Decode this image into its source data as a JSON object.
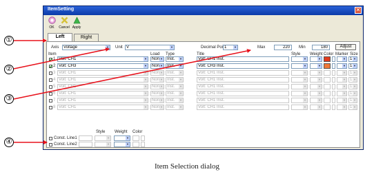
{
  "window": {
    "title": "ItemSetting",
    "close_glyph": "✕"
  },
  "toolbar": [
    {
      "label": "OK",
      "icon": "ok-icon"
    },
    {
      "label": "Cancel",
      "icon": "cancel-icon"
    },
    {
      "label": "Apply",
      "icon": "apply-icon"
    }
  ],
  "tabs": [
    {
      "label": "Left",
      "active": true
    },
    {
      "label": "Right",
      "active": false
    }
  ],
  "settings": {
    "axis_label": "Axis",
    "axis_value": "Voltage",
    "unit_label": "Unit",
    "unit_value": "V",
    "decimal_label": "Decimal Points",
    "decimal_value": "1",
    "max_label": "Max",
    "max_value": "220",
    "min_label": "Min",
    "min_value": "180",
    "adjust_button": "Adjust"
  },
  "headers": {
    "item": "Item",
    "load": "Load",
    "type": "Type",
    "title": "Title",
    "style": "Style",
    "weight": "Weight",
    "color": "Color",
    "marker": "Marker",
    "size": "Size"
  },
  "rows": [
    {
      "num": "1",
      "item": "Volt: CH1",
      "load": "None",
      "type": "Inst.",
      "title": "Volt: CH1 Inst.",
      "size": "1",
      "checked": true,
      "enabled": true,
      "color": "#e23a1c"
    },
    {
      "num": "2",
      "item": "Volt: CH3",
      "load": "None",
      "type": "Inst.",
      "title": "Volt: CH3 Inst.",
      "size": "1",
      "checked": true,
      "enabled": true,
      "color": "#f07838"
    },
    {
      "num": "3",
      "item": "Volt: CH1",
      "load": "None",
      "type": "Inst.",
      "title": "Volt: CH1 Inst.",
      "size": "1",
      "checked": false,
      "enabled": false,
      "color": ""
    },
    {
      "num": "4",
      "item": "Volt: CH1",
      "load": "None",
      "type": "Inst.",
      "title": "Volt: CH1 Inst.",
      "size": "1",
      "checked": false,
      "enabled": false,
      "color": ""
    },
    {
      "num": "5",
      "item": "Volt: CH1",
      "load": "None",
      "type": "Inst.",
      "title": "Volt: CH1 Inst.",
      "size": "1",
      "checked": false,
      "enabled": false,
      "color": ""
    },
    {
      "num": "6",
      "item": "Volt: CH1",
      "load": "None",
      "type": "Inst.",
      "title": "Volt: CH1 Inst.",
      "size": "1",
      "checked": false,
      "enabled": false,
      "color": ""
    },
    {
      "num": "7",
      "item": "Volt: CH1",
      "load": "None",
      "type": "Inst.",
      "title": "Volt: CH1 Inst.",
      "size": "1",
      "checked": false,
      "enabled": false,
      "color": ""
    },
    {
      "num": "8",
      "item": "Volt: CH1",
      "load": "None",
      "type": "Inst.",
      "title": "Volt: CH1 Inst.",
      "size": "1",
      "checked": false,
      "enabled": false,
      "color": ""
    }
  ],
  "const": {
    "style_label": "Style",
    "weight_label": "Weight",
    "color_label": "Color",
    "lines": [
      {
        "label": "Const. Line1"
      },
      {
        "label": "Const. Line2"
      }
    ]
  },
  "callouts": [
    "①",
    "②",
    "③",
    "④"
  ],
  "caption": "Item Selection dialog",
  "colors": {
    "arrow": "#e8121c",
    "titlebar": "#0b3aa8",
    "dialog_bg": "#ece9d8"
  }
}
